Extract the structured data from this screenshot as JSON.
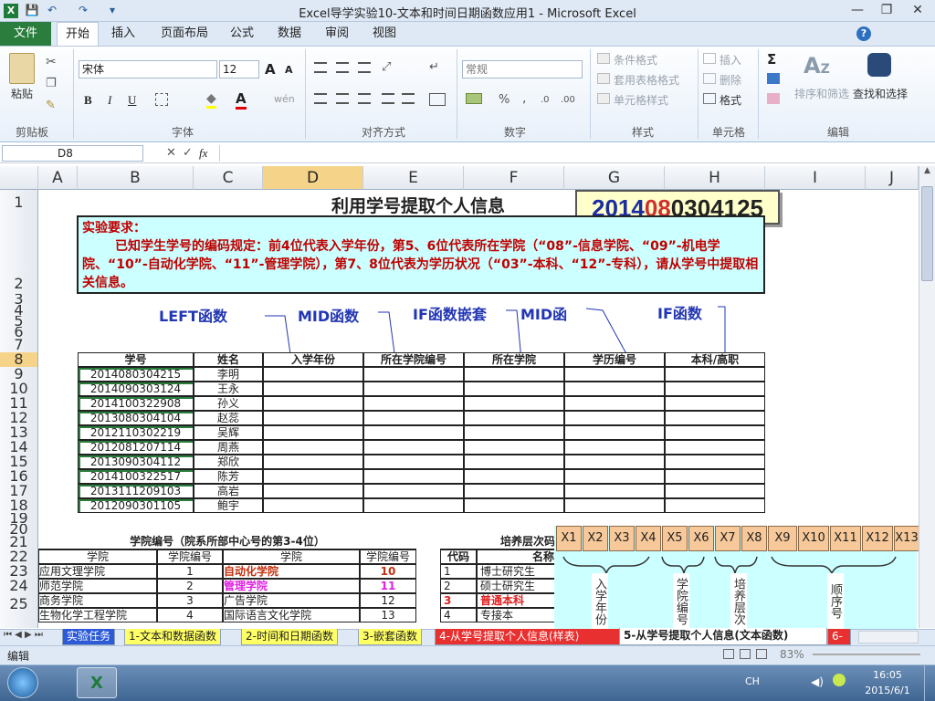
{
  "window": {
    "title": "Excel导学实验10-文本和时间日期函数应用1 - Microsoft Excel",
    "min": "—",
    "restore": "❐",
    "close": "✕"
  },
  "quick_access": {
    "save": "💾",
    "undo": "↶",
    "redo": "↷",
    "more": "▾"
  },
  "ribbon_tabs": [
    "文件",
    "开始",
    "插入",
    "页面布局",
    "公式",
    "数据",
    "审阅",
    "视图"
  ],
  "ribbon": {
    "clipboard": {
      "paste": "粘贴",
      "label": "剪贴板"
    },
    "font": {
      "name": "宋体",
      "size": "12",
      "label": "字体",
      "bold": "B",
      "italic": "I",
      "underline": "U",
      "grow": "A",
      "shrink": "A",
      "color_a": "A",
      "fill": "◆",
      "wen": "wén"
    },
    "alignment": {
      "label": "对齐方式"
    },
    "number": {
      "format": "常规",
      "label": "数字",
      "percent": "%",
      "comma": ","
    },
    "styles": {
      "conditional": "条件格式",
      "table": "套用表格格式",
      "cell": "单元格样式",
      "label": "样式"
    },
    "cells": {
      "insert": "插入",
      "delete": "删除",
      "format": "格式",
      "label": "单元格"
    },
    "editing": {
      "sum": "Σ",
      "sort": "排序和筛选",
      "find": "查找和选择",
      "label": "编辑"
    }
  },
  "formula_bar": {
    "name_box": "D8",
    "fx": "fx",
    "cancel": "✕",
    "enter": "✓",
    "value": ""
  },
  "columns": [
    "A",
    "B",
    "C",
    "D",
    "E",
    "F",
    "G",
    "H",
    "I",
    "J"
  ],
  "rows": [
    "1",
    "2",
    "3",
    "4",
    "5",
    "6",
    "7",
    "8",
    "9",
    "10",
    "11",
    "12",
    "13",
    "14",
    "15",
    "16",
    "17",
    "18",
    "19",
    "20",
    "21",
    "22",
    "23",
    "24",
    "25"
  ],
  "sheet": {
    "title": "利用学号提取个人信息",
    "id_display": {
      "p1": "2014",
      "p2": "08",
      "p3": "03",
      "p4": "04125"
    },
    "requirement_title": "实验要求：",
    "requirement_text": "已知学生学号的编码规定：前4位代表入学年份，第5、6位代表所在学院（“08”-信息学院、“09”-机电学院、“10”-自动化学院、“11”-管理学院），第7、8位代表为学历状况（“03”-本科、“12”-专科），请从学号中提取相关信息。",
    "fn_labels": [
      "LEFT函数",
      "MID函数",
      "IF函数嵌套",
      "MID函",
      "IF函数"
    ],
    "table_headers": [
      "学号",
      "姓名",
      "入学年份",
      "所在学院编号",
      "所在学院",
      "学历编号",
      "本科/高职"
    ],
    "students": [
      {
        "id": "2014080304215",
        "name": "李明"
      },
      {
        "id": "2014090303124",
        "name": "王永"
      },
      {
        "id": "2014100322908",
        "name": "孙义"
      },
      {
        "id": "2013080304104",
        "name": "赵蕊"
      },
      {
        "id": "2012110302219",
        "name": "吴辉"
      },
      {
        "id": "2012081207114",
        "name": "周燕"
      },
      {
        "id": "2013090304112",
        "name": "郑欣"
      },
      {
        "id": "2014100322517",
        "name": "陈芳"
      },
      {
        "id": "2013111209103",
        "name": "高岩"
      },
      {
        "id": "2012090301105",
        "name": "鲍宇"
      }
    ],
    "college_title": "学院编号（院系所部中心号的第3-4位）",
    "college_headers": [
      "学院",
      "学院编号",
      "学院",
      "学院编号"
    ],
    "colleges": [
      {
        "a": "应用文理学院",
        "b": "1",
        "c": "自动化学院",
        "d": "10"
      },
      {
        "a": "师范学院",
        "b": "2",
        "c": "管理学院",
        "d": "11"
      },
      {
        "a": "商务学院",
        "b": "3",
        "c": "广告学院",
        "d": "12"
      },
      {
        "a": "生物化学工程学院",
        "b": "4",
        "c": "国际语言文化学院",
        "d": "13"
      }
    ],
    "level_title": "培养层次码",
    "level_headers": [
      "代码",
      "名称"
    ],
    "levels": [
      {
        "code": "1",
        "name": "博士研究生"
      },
      {
        "code": "2",
        "name": "硕士研究生"
      },
      {
        "code": "3",
        "name": "普通本科"
      },
      {
        "code": "4",
        "name": "专接本"
      }
    ],
    "diagram": {
      "boxes": [
        "X1",
        "X2",
        "X3",
        "X4",
        "X5",
        "X6",
        "X7",
        "X8",
        "X9",
        "X10",
        "X11",
        "X12",
        "X13"
      ],
      "labels": [
        "入学年份",
        "学院编号",
        "培养层次",
        "顺序号"
      ]
    }
  },
  "sheet_tabs": [
    "实验任务",
    "1-文本和数据函数",
    "2-时间和日期函数",
    "3-嵌套函数",
    "4-从学号提取个人信息(样表)",
    "5-从学号提取个人信息(文本函数)",
    "6-"
  ],
  "status": {
    "mode": "编辑",
    "zoom": "83%"
  },
  "taskbar": {
    "ime": "CH",
    "time": "16:05",
    "date": "2015/6/1"
  }
}
